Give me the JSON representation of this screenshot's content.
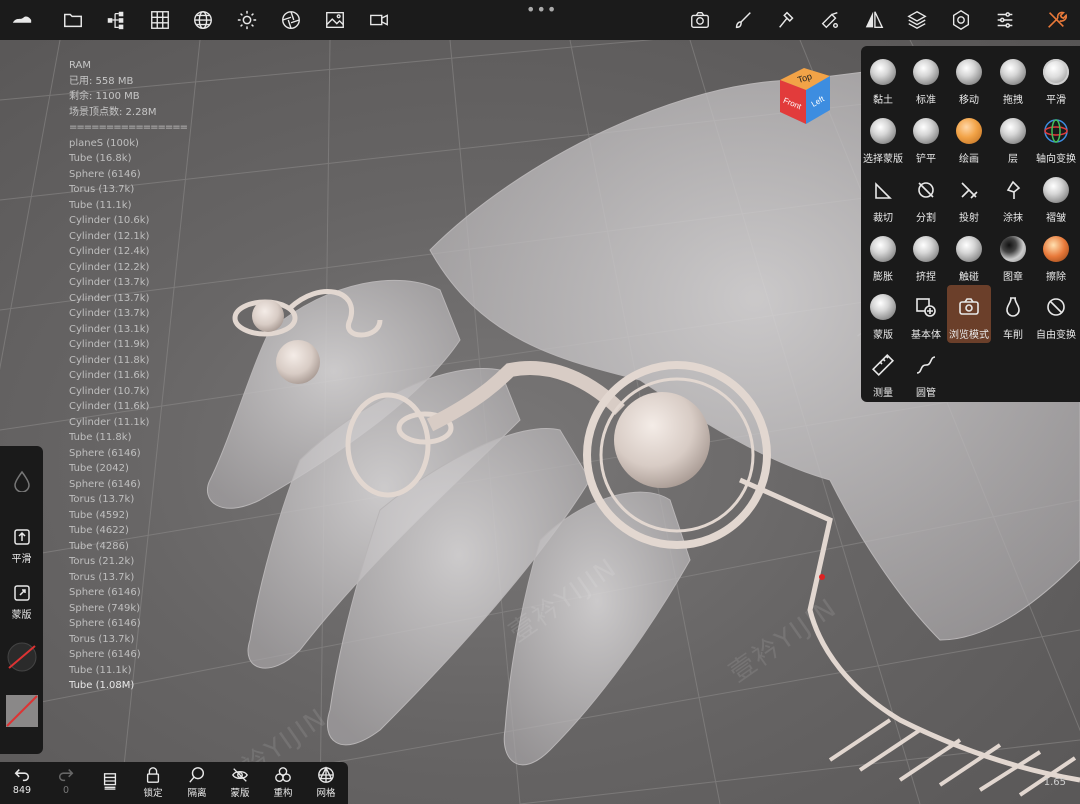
{
  "top_toolbar": {
    "left_icons": [
      "nomad-logo-icon",
      "folder-icon",
      "scene-tree-icon",
      "grid-icon",
      "globe-icon",
      "sun-icon",
      "aperture-icon",
      "image-icon",
      "video-icon"
    ],
    "right_icons": [
      "camera-icon",
      "brush-icon",
      "hammer-icon",
      "paint-icon",
      "mirror-icon",
      "layers-icon",
      "settings-icon",
      "sliders-icon",
      "tools-icon"
    ],
    "more": "•••"
  },
  "stats": {
    "ram_title": "RAM",
    "used": "已用: 558 MB",
    "free": "剩余: 1100 MB",
    "vertices": "场景顶点数: 2.28M",
    "separator": "================",
    "objects": [
      "planeS (100k)",
      "Tube (16.8k)",
      "Sphere (6146)",
      "Torus (13.7k)",
      "Tube (11.1k)",
      "Cylinder (10.6k)",
      "Cylinder (12.1k)",
      "Cylinder (12.4k)",
      "Cylinder (12.2k)",
      "Cylinder (13.7k)",
      "Cylinder (13.7k)",
      "Cylinder (13.7k)",
      "Cylinder (13.1k)",
      "Cylinder (11.9k)",
      "Cylinder (11.8k)",
      "Cylinder (11.6k)",
      "Cylinder (10.7k)",
      "Cylinder (11.6k)",
      "Cylinder (11.1k)",
      "Tube (11.8k)",
      "Sphere (6146)",
      "Tube (2042)",
      "Sphere (6146)",
      "Torus (13.7k)",
      "Tube (4592)",
      "Tube (4622)",
      "Tube (4286)",
      "Torus (21.2k)",
      "Torus (13.7k)",
      "Sphere (6146)",
      "Sphere (749k)",
      "Sphere (6146)",
      "Torus (13.7k)",
      "Sphere (6146)",
      "Tube (11.1k)"
    ],
    "active_object": "Tube (1.08M)"
  },
  "cube": {
    "top": "Top",
    "front": "Front",
    "left": "Left"
  },
  "tools": [
    {
      "label": "黏土",
      "icon": "clay-brush-icon"
    },
    {
      "label": "标准",
      "icon": "standard-brush-icon"
    },
    {
      "label": "移动",
      "icon": "move-brush-icon"
    },
    {
      "label": "拖拽",
      "icon": "drag-brush-icon"
    },
    {
      "label": "平滑",
      "icon": "smooth-brush-icon"
    },
    {
      "label": "选择蒙版",
      "icon": "select-mask-icon"
    },
    {
      "label": "铲平",
      "icon": "flatten-brush-icon"
    },
    {
      "label": "绘画",
      "icon": "paint-brush-icon"
    },
    {
      "label": "层",
      "icon": "layer-brush-icon"
    },
    {
      "label": "轴向变换",
      "icon": "gizmo-transform-icon"
    },
    {
      "label": "裁切",
      "icon": "trim-icon"
    },
    {
      "label": "分割",
      "icon": "split-icon"
    },
    {
      "label": "投射",
      "icon": "project-icon"
    },
    {
      "label": "涂抹",
      "icon": "smudge-icon"
    },
    {
      "label": "褶皱",
      "icon": "crease-brush-icon"
    },
    {
      "label": "膨胀",
      "icon": "inflate-brush-icon"
    },
    {
      "label": "挤捏",
      "icon": "pinch-brush-icon"
    },
    {
      "label": "触碰",
      "icon": "tube-brush-icon"
    },
    {
      "label": "图章",
      "icon": "stamp-brush-icon"
    },
    {
      "label": "擦除",
      "icon": "erase-icon"
    },
    {
      "label": "蒙版",
      "icon": "mask-brush-icon"
    },
    {
      "label": "基本体",
      "icon": "primitive-icon"
    },
    {
      "label": "浏览模式",
      "icon": "view-camera-icon",
      "active": true
    },
    {
      "label": "车削",
      "icon": "lathe-icon"
    },
    {
      "label": "自由变换",
      "icon": "free-transform-icon"
    },
    {
      "label": "测量",
      "icon": "ruler-icon"
    },
    {
      "label": "圆管",
      "icon": "tube-tool-icon"
    }
  ],
  "left_panel": {
    "smooth_label": "平滑",
    "mask_label": "蒙版"
  },
  "bottom_bar": {
    "undo_count": "849",
    "redo_count": "0",
    "items": [
      "锁定",
      "隔离",
      "蒙版",
      "重构",
      "网格"
    ]
  },
  "watermark": "壹衿YIJIN",
  "version": "1.65",
  "colors": {
    "panel_bg": "#1a1a1a",
    "active_tool": "#6b3f2a",
    "accent_orange": "#e8793a"
  }
}
